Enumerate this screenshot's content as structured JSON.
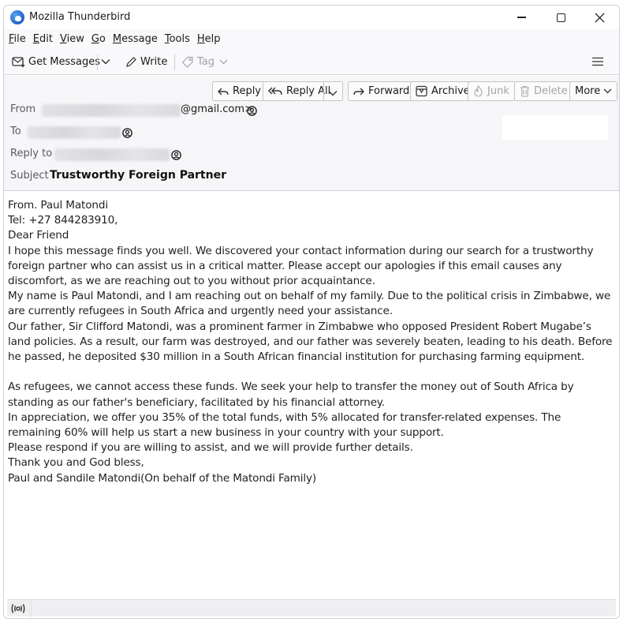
{
  "window": {
    "title": "Mozilla Thunderbird",
    "controls": [
      "minimize",
      "maximize",
      "close"
    ]
  },
  "menubar": {
    "items": [
      {
        "label": "File",
        "accel": "F",
        "rest": "ile"
      },
      {
        "label": "Edit",
        "accel": "E",
        "rest": "dit"
      },
      {
        "label": "View",
        "accel": "V",
        "rest": "iew"
      },
      {
        "label": "Go",
        "accel": "G",
        "rest": "o"
      },
      {
        "label": "Message",
        "accel": "M",
        "rest": "essage"
      },
      {
        "label": "Tools",
        "accel": "T",
        "rest": "ools"
      },
      {
        "label": "Help",
        "accel": "H",
        "rest": "elp"
      }
    ]
  },
  "toolbar": {
    "get_messages_label": "Get Messages",
    "write_label": "Write",
    "tag_label": "Tag",
    "icons": {
      "get_messages": "inbox-download-icon",
      "write": "pencil-icon",
      "tag": "tag-icon",
      "app_menu": "hamburger-menu-icon"
    }
  },
  "message_actions": {
    "reply": "Reply",
    "reply_all": "Reply All",
    "forward": "Forward",
    "archive": "Archive",
    "junk": "Junk",
    "delete": "Delete",
    "more": "More"
  },
  "header": {
    "from_label": "From",
    "from_value_visible": "@gmail.com>",
    "to_label": "To",
    "reply_to_label": "Reply to",
    "subject_label": "Subject",
    "subject": "Trustworthy Foreign Partner"
  },
  "body": {
    "lines": [
      "From. Paul Matondi",
      "Tel: +27 844283910,",
      "Dear Friend",
      "I hope this message finds you well. We discovered your contact information during our search for a trustworthy foreign partner who can assist us in a critical matter. Please accept our apologies if this email causes any discomfort, as we are reaching out to you without prior acquaintance.",
      "My name is Paul Matondi, and I am reaching out on behalf of my family. Due to the political crisis in Zimbabwe, we are currently refugees in South Africa and urgently need your assistance.",
      "Our father, Sir Clifford Matondi, was a prominent farmer in Zimbabwe who opposed President Robert Mugabe’s land policies. As a result, our farm was destroyed, and our father was severely beaten, leading to his death. Before he passed, he deposited $30 million in a South African financial institution for purchasing farming equipment.",
      "",
      "As refugees, we cannot access these funds. We seek your help to transfer the money out of South Africa by standing as our father's beneficiary, facilitated by his financial attorney.",
      "In appreciation, we offer you 35% of the total funds, with 5% allocated for transfer-related expenses. The remaining 60% will help us start a new business in your country with your support.",
      "Please respond if you are willing to assist, and we will provide further details.",
      "Thank you and God bless,",
      "Paul and Sandile Matondi(On behalf of the Matondi Family)"
    ]
  },
  "statusbar": {
    "icon": "online-status-icon"
  }
}
